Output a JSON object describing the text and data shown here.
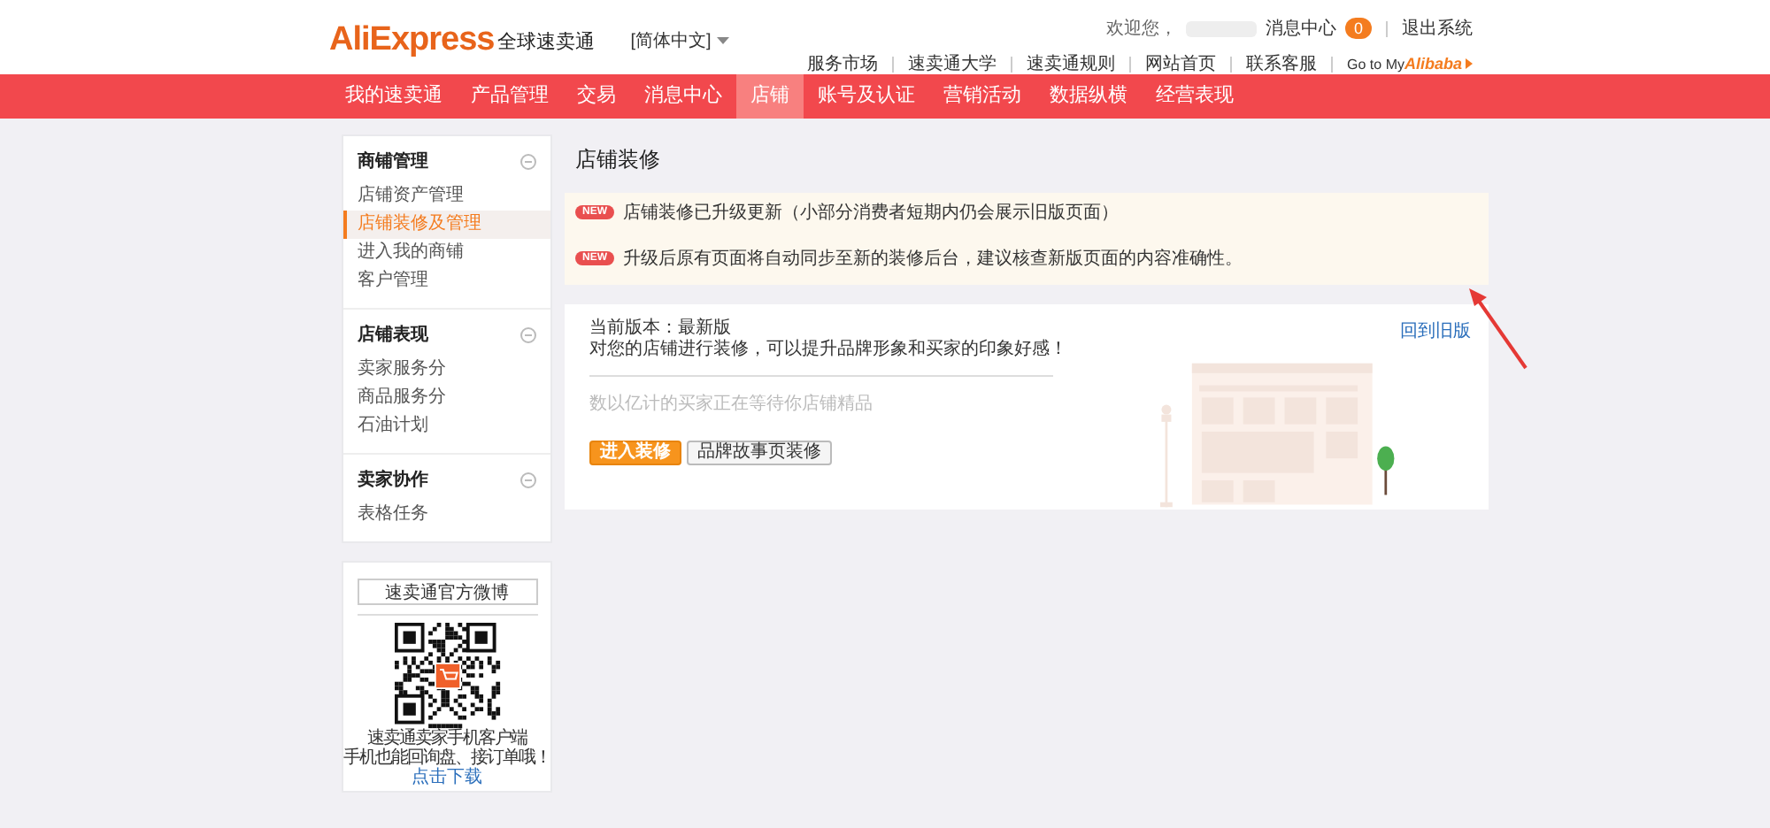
{
  "header": {
    "logo": "AliExpress",
    "logo_cn": "全球速卖通",
    "language": "[简体中文]",
    "welcome": "欢迎您，",
    "messages": "消息中心",
    "message_count": "0",
    "logout": "退出系统",
    "links": [
      "服务市场",
      "速卖通大学",
      "速卖通规则",
      "网站首页",
      "联系客服"
    ],
    "goto": "Go to My",
    "goto_brand": "Alibaba"
  },
  "nav": [
    {
      "label": "我的速卖通",
      "selected": false
    },
    {
      "label": "产品管理",
      "selected": false
    },
    {
      "label": "交易",
      "selected": false
    },
    {
      "label": "消息中心",
      "selected": false
    },
    {
      "label": "店铺",
      "selected": true
    },
    {
      "label": "账号及认证",
      "selected": false
    },
    {
      "label": "营销活动",
      "selected": false
    },
    {
      "label": "数据纵横",
      "selected": false
    },
    {
      "label": "经营表现",
      "selected": false
    }
  ],
  "sidebar": {
    "groups": [
      {
        "title": "商铺管理",
        "expanded": true,
        "items": [
          {
            "label": "店铺资产管理",
            "selected": false
          },
          {
            "label": "店铺装修及管理",
            "selected": true
          },
          {
            "label": "进入我的商铺",
            "selected": false
          },
          {
            "label": "客户管理",
            "selected": false
          }
        ]
      },
      {
        "title": "店铺表现",
        "expanded": true,
        "items": [
          {
            "label": "卖家服务分",
            "selected": false
          },
          {
            "label": "商品服务分",
            "selected": false
          },
          {
            "label": "石油计划",
            "selected": false
          }
        ]
      },
      {
        "title": "卖家协作",
        "expanded": true,
        "items": [
          {
            "label": "表格任务",
            "selected": false
          }
        ]
      }
    ],
    "promo": {
      "button": "速卖通官方微博",
      "lines": [
        "速卖通卖家手机客户端",
        "手机也能回询盘、接订单哦！"
      ],
      "link": "点击下载"
    }
  },
  "main": {
    "title": "店铺装修",
    "notices": [
      {
        "badge": "NEW",
        "text": "店铺装修已升级更新（小部分消费者短期内仍会展示旧版页面）"
      },
      {
        "badge": "NEW",
        "text": "升级后原有页面将自动同步至新的装修后台，建议核查新版页面的内容准确性。"
      }
    ],
    "panel": {
      "version": "当前版本：最新版",
      "description": "对您的店铺进行装修，可以提升品牌形象和买家的印象好感！",
      "tagline": "数以亿计的买家正在等待你店铺精品",
      "old_version_link": "回到旧版",
      "buttons": [
        {
          "label": "进入装修",
          "kind": "primary"
        },
        {
          "label": "品牌故事页装修",
          "kind": "default"
        }
      ]
    }
  }
}
